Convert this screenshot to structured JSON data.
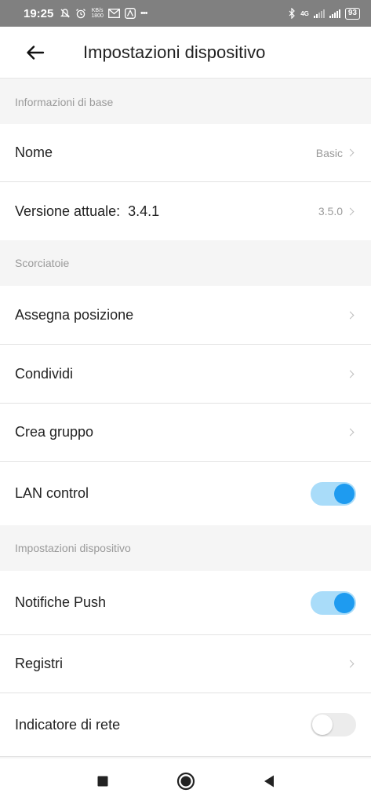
{
  "status_bar": {
    "time": "19:25",
    "battery": "93",
    "network": "4G",
    "left_icons": [
      "mute-icon",
      "alarm-icon",
      "data-speed-icon",
      "gmail-icon",
      "app-icon",
      "more-dots-icon"
    ],
    "speed_label_top": "KB/s",
    "speed_label_bottom": "1800",
    "more": "•••"
  },
  "header": {
    "title": "Impostazioni dispositivo",
    "back_icon": "arrow-left-icon"
  },
  "sections": {
    "basic": {
      "title": "Informazioni di base",
      "name_label": "Nome",
      "name_value": "Basic",
      "version_label": "Versione attuale:  3.4.1",
      "version_value": "3.5.0"
    },
    "shortcuts": {
      "title": "Scorciatoie",
      "assign_label": "Assegna posizione",
      "share_label": "Condividi",
      "group_label": "Crea gruppo",
      "lan_label": "LAN control",
      "lan_on": true
    },
    "device": {
      "title": "Impostazioni dispositivo",
      "push_label": "Notifiche Push",
      "push_on": true,
      "logs_label": "Registri",
      "indicator_label": "Indicatore di rete",
      "indicator_on": false
    }
  },
  "colors": {
    "accent": "#1e9bf0",
    "accent_track": "#a9dcf9",
    "status_bar": "#808080",
    "background": "#f5f5f5"
  },
  "nav_bar": {
    "icons": [
      "recents-square-icon",
      "home-circle-icon",
      "back-triangle-icon"
    ]
  }
}
